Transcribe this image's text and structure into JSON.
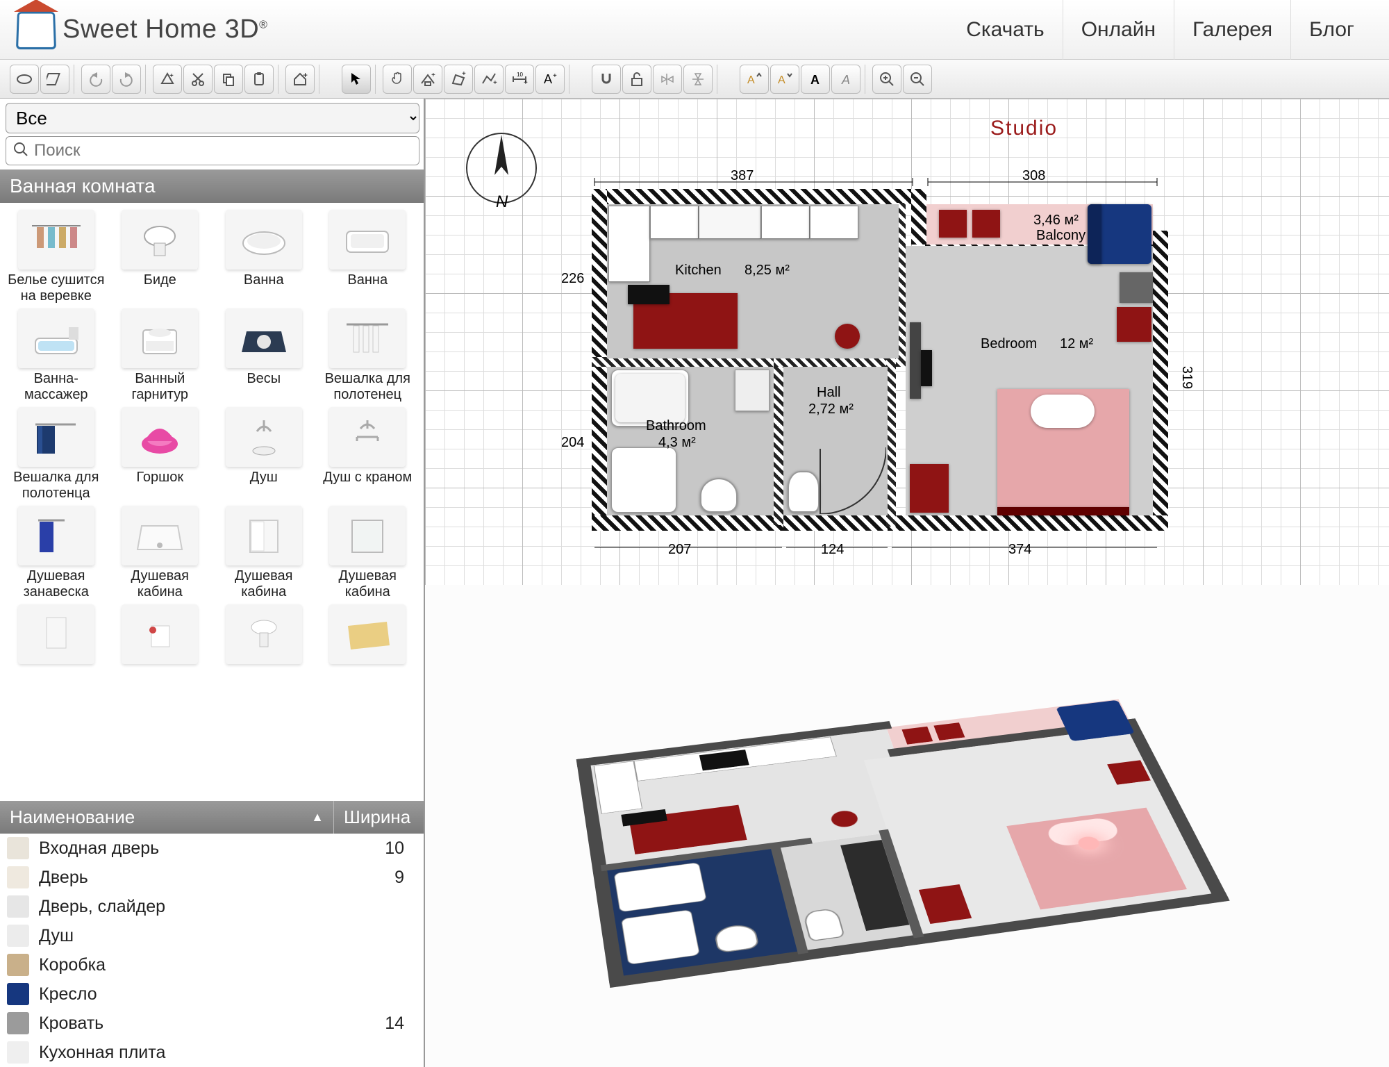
{
  "app": {
    "name": "Sweet Home 3D",
    "reg": "®"
  },
  "nav": [
    "Скачать",
    "Онлайн",
    "Галерея",
    "Блог"
  ],
  "left": {
    "category_selected": "Все",
    "search_placeholder": "Поиск",
    "section_title": "Ванная комната",
    "catalog": [
      [
        "Белье сушится на веревке",
        "Биде",
        "Ванна",
        "Ванна"
      ],
      [
        "Ванна-массажер",
        "Ванный гарнитур",
        "Весы",
        "Вешалка для полотенец"
      ],
      [
        "Вешалка для полотенца",
        "Горшок",
        "Душ",
        "Душ с краном"
      ],
      [
        "Душевая занавеска",
        "Душевая кабина",
        "Душевая кабина",
        "Душевая кабина"
      ]
    ],
    "table": {
      "col_name": "Наименование",
      "col_width": "Ширина",
      "rows": [
        {
          "name": "Входная дверь",
          "w": "10"
        },
        {
          "name": "Дверь",
          "w": "9"
        },
        {
          "name": "Дверь, слайдер",
          "w": ""
        },
        {
          "name": "Душ",
          "w": ""
        },
        {
          "name": "Коробка",
          "w": ""
        },
        {
          "name": "Кресло",
          "w": ""
        },
        {
          "name": "Кровать",
          "w": "14"
        },
        {
          "name": "Кухонная плита",
          "w": ""
        }
      ]
    }
  },
  "plan": {
    "title": "Studio",
    "compass_label": "N",
    "dims": {
      "top_left": "387",
      "top_right": "308",
      "left_upper": "226",
      "left_lower": "204",
      "right": "319",
      "bottom_left": "207",
      "bottom_mid": "124",
      "bottom_right": "374"
    },
    "rooms": {
      "kitchen": {
        "label": "Kitchen",
        "area": "8,25 м²"
      },
      "balcony": {
        "label": "Balcony",
        "area": "3,46 м²"
      },
      "bedroom": {
        "label": "Bedroom",
        "area": "12 м²"
      },
      "bathroom": {
        "label": "Bathroom",
        "area": "4,3 м²"
      },
      "hall": {
        "label": "Hall",
        "area": "2,72 м²"
      }
    }
  },
  "colors": {
    "accent_red": "#8f1414",
    "bed_pink": "#e6a7aa",
    "chair_blue": "#16377f",
    "balcony_pink": "#f1cfcf",
    "wall": "#3a3a3a"
  }
}
